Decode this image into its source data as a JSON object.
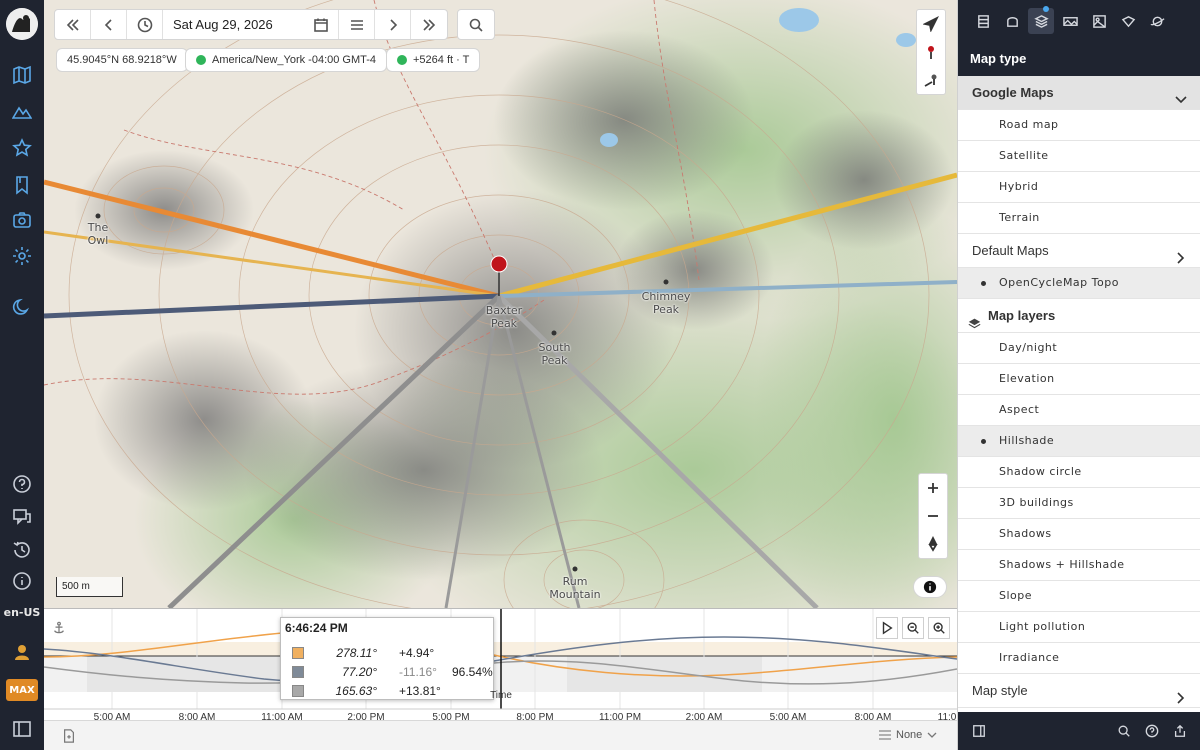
{
  "rail": {
    "language": "en-US",
    "badge": "MAX"
  },
  "toolbar": {
    "date": "Sat Aug 29, 2026"
  },
  "chips": {
    "coords": "45.9045°N 68.9218°W",
    "timezone": "America/New_York -04:00 GMT-4",
    "elevation": "+5264 ft · T"
  },
  "map": {
    "scale_label": "500 m",
    "places": {
      "owl": "The\nOwl",
      "baxter": "Baxter\nPeak",
      "chimney": "Chimney\nPeak",
      "south": "South\nPeak",
      "rum": "Rum\nMountain"
    },
    "colors": {
      "sun_line": "#e88a35",
      "sun_line_light": "#e6b450",
      "moon_line": "#4d5b78",
      "moon_line_light": "#8fb0c8",
      "gray_line": "#8e8e8e"
    }
  },
  "timeline": {
    "ticks": [
      "5:00 AM",
      "8:00 AM",
      "11:00 AM",
      "2:00 PM",
      "5:00 PM",
      "8:00 PM",
      "11:00 PM",
      "2:00 AM",
      "5:00 AM",
      "8:00 AM",
      "11:0"
    ],
    "time_label": "Time",
    "tooltip": {
      "time": "6:46:24 PM",
      "rows": [
        {
          "azimuth": "278.11°",
          "altitude": "+4.94°",
          "extra": "",
          "color": "#f0b060"
        },
        {
          "azimuth": "77.20°",
          "altitude": "-11.16°",
          "extra": "96.54%",
          "color": "#7f8a98"
        },
        {
          "azimuth": "165.63°",
          "altitude": "+13.81°",
          "extra": "",
          "color": "#a8a8a8"
        }
      ]
    }
  },
  "status": {
    "select_value": "None"
  },
  "panel": {
    "title": "Map type",
    "google_maps": "Google Maps",
    "google_items": [
      "Road map",
      "Satellite",
      "Hybrid",
      "Terrain"
    ],
    "default_maps": "Default Maps",
    "default_selected": "OpenCycleMap Topo",
    "map_layers": "Map layers",
    "layer_items": [
      "Day/night",
      "Elevation",
      "Aspect",
      "Hillshade",
      "Shadow circle",
      "3D buildings",
      "Shadows",
      "Shadows + Hillshade",
      "Slope",
      "Light pollution",
      "Irradiance"
    ],
    "selected_layer": "Hillshade",
    "map_style": "Map style"
  }
}
